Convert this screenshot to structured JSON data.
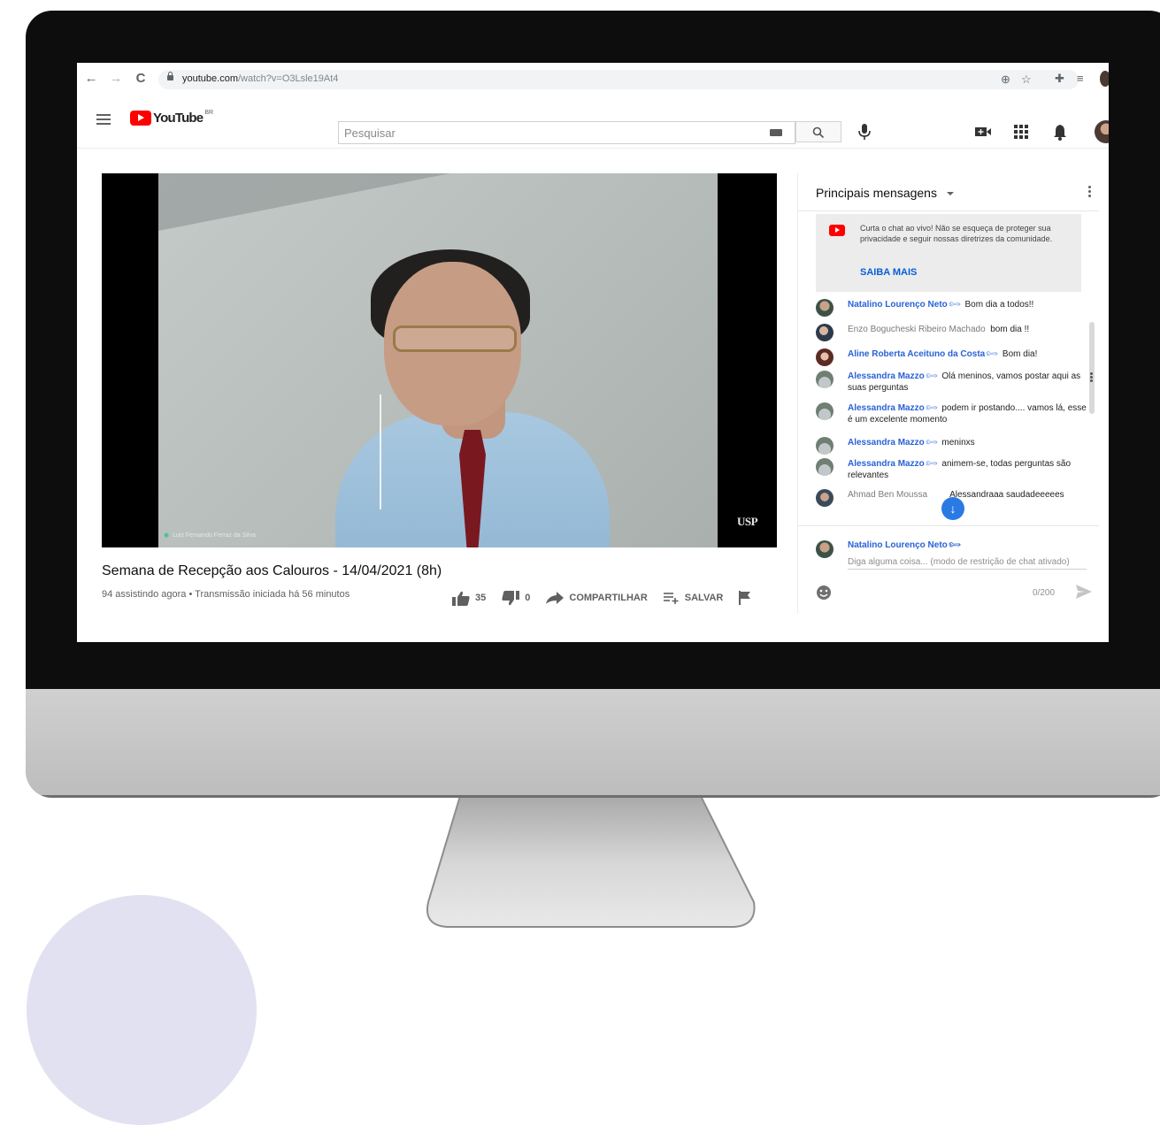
{
  "browser": {
    "url_host": "youtube.com",
    "url_path": "/watch?v=O3Lsle19At4"
  },
  "masthead": {
    "logo_text": "YouTube",
    "region": "BR",
    "search_placeholder": "Pesquisar"
  },
  "video": {
    "presenter_name": "Luiz Fernando Ferraz da Silva",
    "watermark": "USP",
    "title": "Semana de Recepção aos Calouros - 14/04/2021 (8h)",
    "meta": "94 assistindo agora • Transmissão iniciada há 56 minutos",
    "likes": "35",
    "dislikes": "0",
    "share_label": "COMPARTILHAR",
    "save_label": "SALVAR"
  },
  "chat": {
    "header": "Principais mensagens",
    "notice_text": "Curta o chat ao vivo! Não se esqueça de proteger sua privacidade e seguir nossas diretrizes da comunidade.",
    "notice_link": "SAIBA MAIS",
    "messages": [
      {
        "author": "Natalino Lourenço Neto",
        "text": "Bom dia a todos!!"
      },
      {
        "author": "Enzo Bogucheski Ribeiro Machado",
        "text": "bom dia !!"
      },
      {
        "author": "Aline Roberta Aceituno da Costa",
        "text": "Bom dia!"
      },
      {
        "author": "Alessandra Mazzo",
        "text": "Olá meninos, vamos postar aqui as suas perguntas"
      },
      {
        "author": "Alessandra Mazzo",
        "text": "podem ir postando.... vamos lá, esse é um excelente momento"
      },
      {
        "author": "Alessandra Mazzo",
        "text": "meninxs"
      },
      {
        "author": "Alessandra Mazzo",
        "text": "animem-se, todas perguntas são relevantes"
      },
      {
        "author": "Ahmad Ben Moussa",
        "text": "Alessandraaa saudadeeeees"
      }
    ],
    "composer_name": "Natalino Lourenço Neto",
    "composer_placeholder": "Diga alguma coisa... (modo de restrição de chat ativado)",
    "char_count": "0/200"
  },
  "colors": {
    "youtube_red": "#ff0000",
    "link_blue": "#065fd4",
    "author_blue": "#2962d6"
  }
}
